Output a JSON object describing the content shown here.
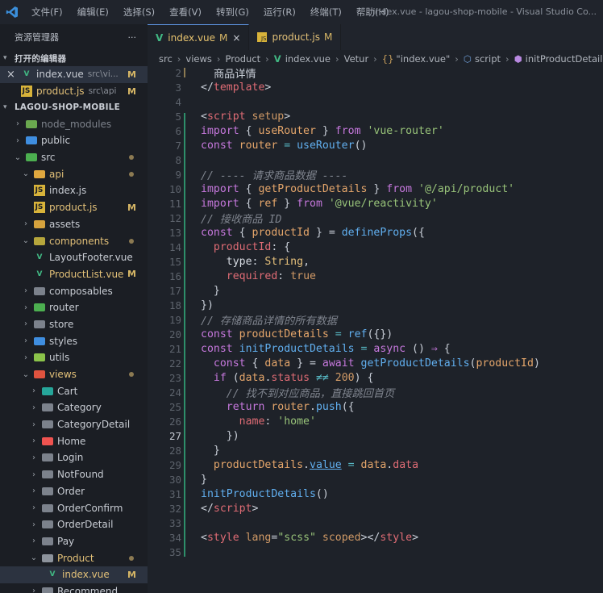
{
  "titlebar": {
    "menu": [
      "文件(F)",
      "编辑(E)",
      "选择(S)",
      "查看(V)",
      "转到(G)",
      "运行(R)",
      "终端(T)",
      "帮助(H)"
    ],
    "window_title": "index.vue - lagou-shop-mobile - Visual Studio Co..."
  },
  "sidebar": {
    "header": "资源管理器",
    "more": "···",
    "open_editors_title": "打开的编辑器",
    "open_editors": [
      {
        "name": "index.vue",
        "path": "src\\vi...",
        "badge": "M"
      },
      {
        "name": "product.js",
        "path": "src\\api",
        "badge": "M"
      }
    ],
    "project_title": "LAGOU-SHOP-MOBILE",
    "tree": [
      {
        "label": "node_modules"
      },
      {
        "label": "public"
      },
      {
        "label": "src"
      },
      {
        "label": "api"
      },
      {
        "label": "index.js"
      },
      {
        "label": "product.js",
        "badge": "M"
      },
      {
        "label": "assets"
      },
      {
        "label": "components"
      },
      {
        "label": "LayoutFooter.vue"
      },
      {
        "label": "ProductList.vue",
        "badge": "M"
      },
      {
        "label": "composables"
      },
      {
        "label": "router"
      },
      {
        "label": "store"
      },
      {
        "label": "styles"
      },
      {
        "label": "utils"
      },
      {
        "label": "views"
      },
      {
        "label": "Cart"
      },
      {
        "label": "Category"
      },
      {
        "label": "CategoryDetail"
      },
      {
        "label": "Home"
      },
      {
        "label": "Login"
      },
      {
        "label": "NotFound"
      },
      {
        "label": "Order"
      },
      {
        "label": "OrderConfirm"
      },
      {
        "label": "OrderDetail"
      },
      {
        "label": "Pay"
      },
      {
        "label": "Product"
      },
      {
        "label": "index.vue",
        "badge": "M"
      },
      {
        "label": "Recommend"
      }
    ]
  },
  "tabs": [
    {
      "label": "index.vue",
      "badge": "M",
      "close": "×"
    },
    {
      "label": "product.js",
      "badge": "M"
    }
  ],
  "breadcrumb": {
    "src": "src",
    "views": "views",
    "product": "Product",
    "file": "index.vue",
    "vetur": "Vetur",
    "braces": "{}",
    "obj": "\"index.vue\"",
    "script": "script",
    "fn": "initProductDetails"
  },
  "editor": {
    "current_line": 27,
    "line_numbers": [
      "2",
      "3",
      "4",
      "5",
      "6",
      "7",
      "8",
      "9",
      "10",
      "11",
      "12",
      "13",
      "14",
      "15",
      "16",
      "17",
      "18",
      "19",
      "20",
      "21",
      "22",
      "23",
      "24",
      "25",
      "26",
      "27",
      "28",
      "29",
      "30",
      "31",
      "32",
      "33",
      "34",
      "35"
    ],
    "tokens": {
      "l2": "商品详情",
      "l3_a": "</",
      "l3_b": "template",
      "l3_c": ">",
      "l5_a": "<",
      "l5_b": "script",
      "l5_c": " setup",
      "l5_d": ">",
      "l6_a": "import",
      "l6_b": " { ",
      "l6_c": "useRouter",
      "l6_d": " } ",
      "l6_e": "from",
      "l6_f": " ",
      "l6_g": "'vue-router'",
      "l7_a": "const",
      "l7_b": " router",
      "l7_c": " = ",
      "l7_d": "useRouter",
      "l7_e": "()",
      "l9": "// ---- 请求商品数据 ----",
      "l10_a": "import",
      "l10_b": " { ",
      "l10_c": "getProductDetails",
      "l10_d": " } ",
      "l10_e": "from",
      "l10_f": " ",
      "l10_g": "'@/api/product'",
      "l11_a": "import",
      "l11_b": " { ",
      "l11_c": "ref",
      "l11_d": " } ",
      "l11_e": "from",
      "l11_f": " ",
      "l11_g": "'@vue/reactivity'",
      "l12": "// 接收商品 ID",
      "l13_a": "const",
      "l13_b": " { ",
      "l13_c": "productId",
      "l13_d": " } = ",
      "l13_e": "defineProps",
      "l13_f": "({",
      "l14_a": "  ",
      "l14_b": "productId",
      "l14_c": ": {",
      "l15_a": "    ",
      "l15_b": "type",
      "l15_c": ": ",
      "l15_d": "String",
      "l15_e": ",",
      "l16_a": "    ",
      "l16_b": "required",
      "l16_c": ": ",
      "l16_d": "true",
      "l17": "  }",
      "l18": "})",
      "l19": "// 存储商品详情的所有数据",
      "l20_a": "const",
      "l20_b": " productDetails",
      "l20_c": " = ",
      "l20_d": "ref",
      "l20_e": "({})",
      "l21_a": "const",
      "l21_b": " ",
      "l21_c": "initProductDetails",
      "l21_d": " = ",
      "l21_e": "async",
      "l21_f": " () ",
      "l21_g": "⇒",
      "l21_h": " {",
      "l22_a": "  ",
      "l22_b": "const",
      "l22_c": " { ",
      "l22_d": "data",
      "l22_e": " } = ",
      "l22_f": "await",
      "l22_g": " ",
      "l22_h": "getProductDetails",
      "l22_i": "(",
      "l22_j": "productId",
      "l22_k": ")",
      "l23_a": "  ",
      "l23_b": "if",
      "l23_c": " (",
      "l23_d": "data",
      "l23_e": ".",
      "l23_f": "status",
      "l23_g": " ≠≠ ",
      "l23_h": "200",
      "l23_i": ") {",
      "l24": "    // 找不到对应商品，直接跳回首页",
      "l25_a": "    ",
      "l25_b": "return",
      "l25_c": " ",
      "l25_d": "router",
      "l25_e": ".",
      "l25_f": "push",
      "l25_g": "({",
      "l26_a": "      ",
      "l26_b": "name",
      "l26_c": ": ",
      "l26_d": "'home'",
      "l27": "    })",
      "l28": "  }",
      "l29_a": "  ",
      "l29_b": "productDetails",
      "l29_c": ".",
      "l29_d": "value",
      "l29_e": " = ",
      "l29_f": "data",
      "l29_g": ".",
      "l29_h": "data",
      "l30": "}",
      "l31_a": "initProductDetails",
      "l31_b": "()",
      "l32_a": "</",
      "l32_b": "script",
      "l32_c": ">",
      "l34_a": "<",
      "l34_b": "style",
      "l34_c": " lang",
      "l34_d": "=",
      "l34_e": "\"scss\"",
      "l34_f": " scoped",
      "l34_g": "></",
      "l34_h": "style",
      "l34_i": ">"
    }
  }
}
